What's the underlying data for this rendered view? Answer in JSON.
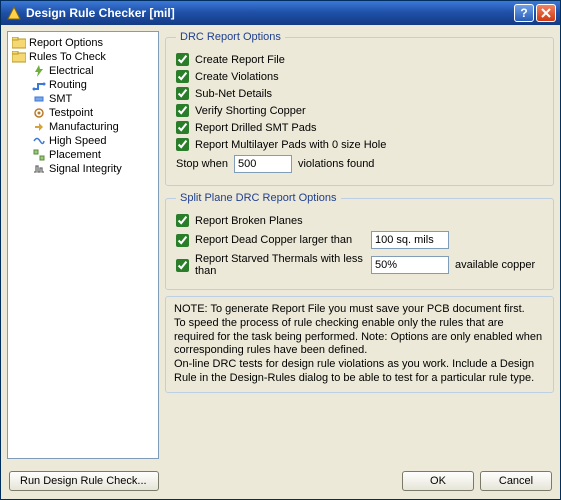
{
  "window": {
    "title": "Design Rule Checker [mil]"
  },
  "tree": {
    "report_options": "Report Options",
    "rules_to_check": "Rules To Check",
    "children": {
      "electrical": "Electrical",
      "routing": "Routing",
      "smt": "SMT",
      "testpoint": "Testpoint",
      "manufacturing": "Manufacturing",
      "high_speed": "High Speed",
      "placement": "Placement",
      "signal_integrity": "Signal Integrity"
    }
  },
  "drc": {
    "legend": "DRC Report Options",
    "create_report_file": "Create Report File",
    "create_violations": "Create Violations",
    "sub_net_details": "Sub-Net Details",
    "verify_shorting_copper": "Verify Shorting Copper",
    "report_drilled_smt": "Report Drilled SMT Pads",
    "report_multilayer": "Report Multilayer Pads with 0 size Hole",
    "stop_when_pre": "Stop when",
    "stop_when_value": "500",
    "stop_when_post": "violations found"
  },
  "split": {
    "legend": "Split Plane DRC Report Options",
    "report_broken": "Report Broken Planes",
    "report_dead_copper": "Report Dead Copper larger than",
    "dead_copper_value": "100 sq. mils",
    "report_starved": "Report Starved Thermals with less than",
    "starved_value": "50%",
    "starved_post": "available copper"
  },
  "notes": {
    "l1": "NOTE: To generate Report File you must save your PCB document first.",
    "l2": "To speed the process of rule checking enable only the rules that are required for the task being performed.  Note: Options are only enabled when corresponding rules have been defined.",
    "l3": "On-line DRC tests for design rule violations as you work. Include a Design Rule in the Design-Rules dialog to be able to test for a particular rule  type."
  },
  "footer": {
    "run": "Run Design Rule Check...",
    "ok": "OK",
    "cancel": "Cancel"
  }
}
